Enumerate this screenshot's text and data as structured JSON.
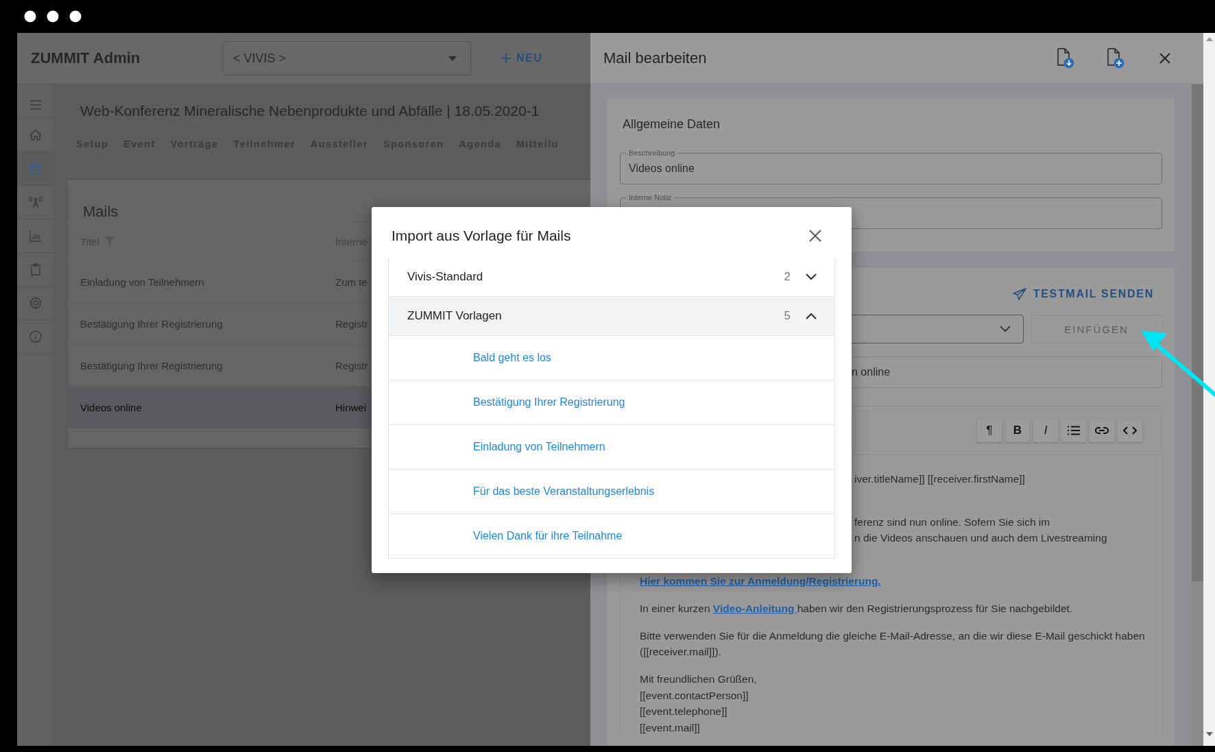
{
  "app": {
    "title": "ZUMMIT Admin",
    "org_select": {
      "value": "< VIVIS >"
    },
    "new_button": "NEU"
  },
  "sidebar": {
    "items": [
      {
        "kind": "menu",
        "selected": false
      },
      {
        "kind": "home",
        "selected": false
      },
      {
        "kind": "calendar",
        "selected": true
      },
      {
        "kind": "antenna",
        "selected": false
      },
      {
        "kind": "chart",
        "selected": false
      },
      {
        "kind": "clipboard",
        "selected": false
      },
      {
        "kind": "settings",
        "selected": false
      },
      {
        "kind": "info",
        "selected": false
      }
    ]
  },
  "event": {
    "title": "Web-Konferenz Mineralische Nebenprodukte und Abfälle | 18.05.2020-1",
    "tabs": [
      {
        "label": "Setup",
        "selected": false
      },
      {
        "label": "Event",
        "selected": false
      },
      {
        "label": "Vorträge",
        "selected": false
      },
      {
        "label": "Teilnehmer",
        "selected": false
      },
      {
        "label": "Aussteller",
        "selected": false
      },
      {
        "label": "Sponsoren",
        "selected": false
      },
      {
        "label": "Agenda",
        "selected": false
      },
      {
        "label": "Mitteilu",
        "selected": false
      }
    ]
  },
  "mails": {
    "title": "Mails",
    "columns": [
      "Titel",
      "Interne"
    ],
    "rows": [
      {
        "cells": [
          "Einladung von Teilnehmern",
          "Zum te"
        ],
        "selected": false
      },
      {
        "cells": [
          "Bestätigung Ihrer Registrierung",
          "Registr"
        ],
        "selected": false
      },
      {
        "cells": [
          "Bestätigung Ihrer Registrierung",
          "Registr"
        ],
        "selected": false
      },
      {
        "cells": [
          "Videos online",
          "Hinwei"
        ],
        "selected": true
      }
    ]
  },
  "modal": {
    "title": "Import aus Vorlage für Mails",
    "groups": [
      {
        "name": "Vivis-Standard",
        "count": "2",
        "expanded": false
      },
      {
        "name": "ZUMMIT Vorlagen",
        "count": "5",
        "expanded": true,
        "items": [
          "Bald geht es los",
          "Bestätigung Ihrer Registrierung",
          "Einladung von Teilnehmern",
          "Für das beste Veranstaltungserlebnis",
          "Vielen Dank für ihre Teilnahme"
        ]
      }
    ]
  },
  "drawer": {
    "title": "Mail bearbeiten",
    "general": {
      "title": "Allgemeine Daten",
      "fields": [
        {
          "label": "Beschreibung",
          "value": "Videos online"
        },
        {
          "label": "Interne Notiz"
        }
      ]
    },
    "testmail_button": "TESTMAIL SENDEN",
    "insert_button": {
      "label": "EINFÜGEN",
      "disabled": true
    },
    "subject": {
      "value": "n online"
    },
    "toolbar": [
      {
        "kind": "paragraph",
        "glyph": "¶"
      },
      {
        "kind": "bold",
        "glyph": "B"
      },
      {
        "kind": "italic",
        "glyph": "I"
      },
      {
        "kind": "list"
      },
      {
        "kind": "link"
      },
      {
        "kind": "code"
      }
    ],
    "body": [
      {
        "kind": "cut",
        "lines": [
          "iver.titleName]] [[receiver.firstName]]"
        ]
      },
      {
        "kind": "cut",
        "lines": [
          "ferenz sind nun online. Sofern Sie sich im",
          "n die Videos anschauen und auch dem Livestreaming"
        ]
      },
      {
        "kind": "link",
        "text": "Hier kommen Sie zur Anmeldung/Registrierung."
      },
      {
        "kind": "inline_link",
        "before": "In einer kurzen ",
        "link": "Video-Anleitung ",
        "after": "haben wir den Registrierungsprozess für Sie nachgebildet."
      },
      {
        "kind": "text",
        "lines": [
          "Bitte verwenden Sie für die Anmeldung die gleiche E-Mail-Adresse, an die wir diese E-Mail geschickt haben ([[receiver.mail]])."
        ]
      },
      {
        "kind": "text",
        "lines": [
          "Mit freundlichen Grüßen,",
          "[[event.contactPerson]]",
          "[[event.telephone]]",
          "[[event.mail]]"
        ]
      }
    ]
  }
}
